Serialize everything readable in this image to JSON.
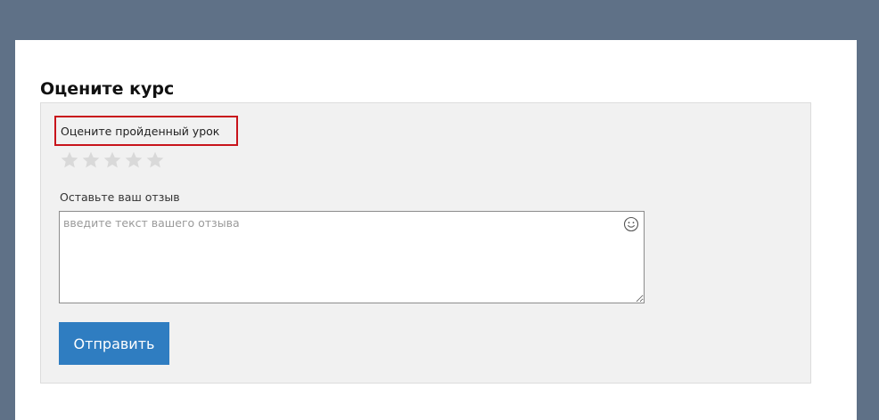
{
  "title": "Оцените курс",
  "rating": {
    "label": "Оцените пройденный урок",
    "max_stars": 5,
    "value": 0,
    "star_empty_color": "#d9d9d9",
    "star_filled_color": "#f5b301"
  },
  "review": {
    "label": "Оставьте ваш отзыв",
    "placeholder": "введите текст вашего отзыва",
    "value": "",
    "emoji_icon": "smiley-icon"
  },
  "submit": {
    "label": "Отправить",
    "color": "#2f7dc1"
  },
  "colors": {
    "background": "#5f7187",
    "card": "#ffffff",
    "panel": "#f1f1f1",
    "highlight": "#c8141b"
  }
}
